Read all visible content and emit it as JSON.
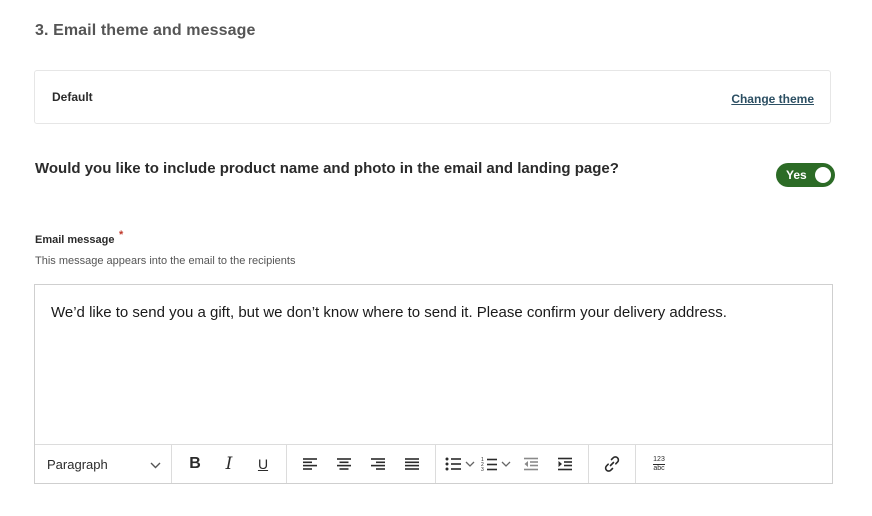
{
  "section": {
    "title": "3. Email theme and message"
  },
  "theme": {
    "name": "Default",
    "change_label": "Change theme"
  },
  "product_option": {
    "question": "Would you like to include product name and photo in the email and landing page?",
    "toggle_label": "Yes",
    "toggle_on": true,
    "toggle_color": "#2c6b26"
  },
  "email_message": {
    "label": "Email message",
    "required_mark": "*",
    "help": "This message appears into the email to the recipients",
    "content": "We’d like to send you a gift, but we don’t know where to send it. Please confirm your delivery address."
  },
  "toolbar": {
    "paragraph_label": "Paragraph",
    "bold_label": "B",
    "italic_label": "I",
    "underline_label": "U",
    "spellcheck_top": "123",
    "spellcheck_bottom": "abc",
    "icons": [
      "chevron-down-icon",
      "align-left-icon",
      "align-center-icon",
      "align-right-icon",
      "align-justify-icon",
      "bullet-list-icon",
      "numbered-list-icon",
      "outdent-icon",
      "indent-icon",
      "link-icon",
      "spellcheck-icon"
    ]
  }
}
